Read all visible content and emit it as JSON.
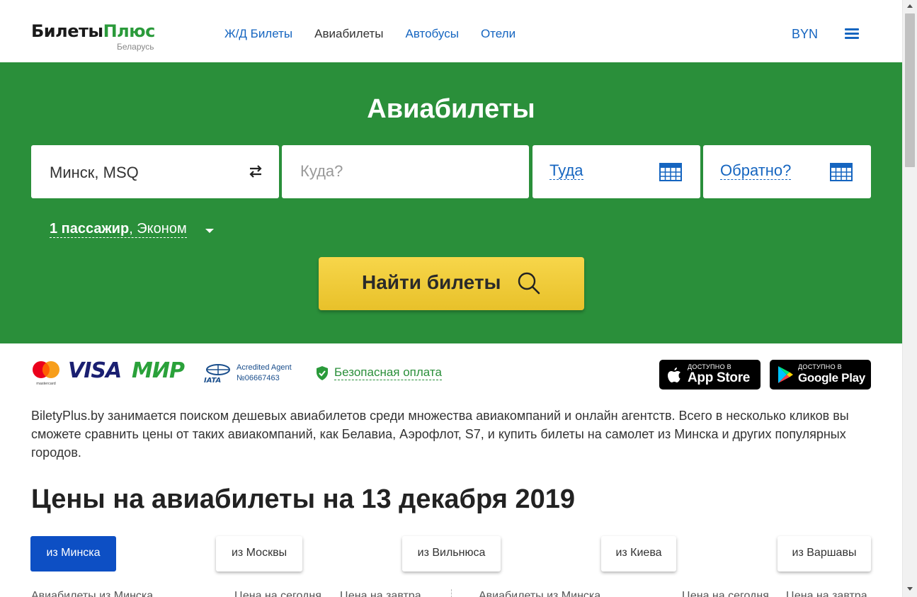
{
  "header": {
    "logo_main": "Билеты",
    "logo_plus": "Плюс",
    "logo_sub": "Беларусь",
    "nav": [
      "Ж/Д Билеты",
      "Авиабилеты",
      "Автобусы",
      "Отели"
    ],
    "active_nav": "Авиабилеты",
    "currency": "BYN",
    "menu_icon": "hamburger-icon"
  },
  "hero": {
    "title": "Авиабилеты",
    "from_value": "Минск, MSQ",
    "to_placeholder": "Куда?",
    "depart_label": "Туда",
    "return_label": "Обратно?",
    "passengers_bold": "1 пассажир",
    "passengers_rest": ", Эконом",
    "search_button": "Найти билеты",
    "colors": {
      "hero_bg": "#2a8f3a",
      "button": "#f0cc3a"
    }
  },
  "payments": {
    "visa": "VISA",
    "mir": "МИР",
    "mastercard_caption": "mastercard",
    "iata_line1": "Acredited Agent",
    "iata_line2": "№06667463",
    "iata_mark": "IATA",
    "secure_label": "Безопасная оплата",
    "appstore_small": "ДОСТУПНО В",
    "appstore_big": "App Store",
    "gplay_small": "ДОСТУПНО В",
    "gplay_big": "Google Play"
  },
  "description": "BiletyPlus.by занимается поиском дешевых авиабилетов среди множества авиакомпаний и онлайн агентств. Всего в несколько кликов вы сможете сравнить цены от таких авиакомпаний, как Белавиа, Аэрофлот, S7, и купить билеты на самолет из Минска и других популярных городов.",
  "prices_heading": "Цены на авиабилеты на 13 декабря 2019",
  "city_tabs": [
    "из Минска",
    "из Москвы",
    "из Вильнюса",
    "из Киева",
    "из Варшавы"
  ],
  "active_tab": "из Минска",
  "table_headers_cut": [
    "Авиабилеты из Минска",
    "Цена на сегодня",
    "Цена на завтра",
    "Авиабилеты из Минска",
    "Цена на сегодня",
    "Цена на завтра"
  ]
}
